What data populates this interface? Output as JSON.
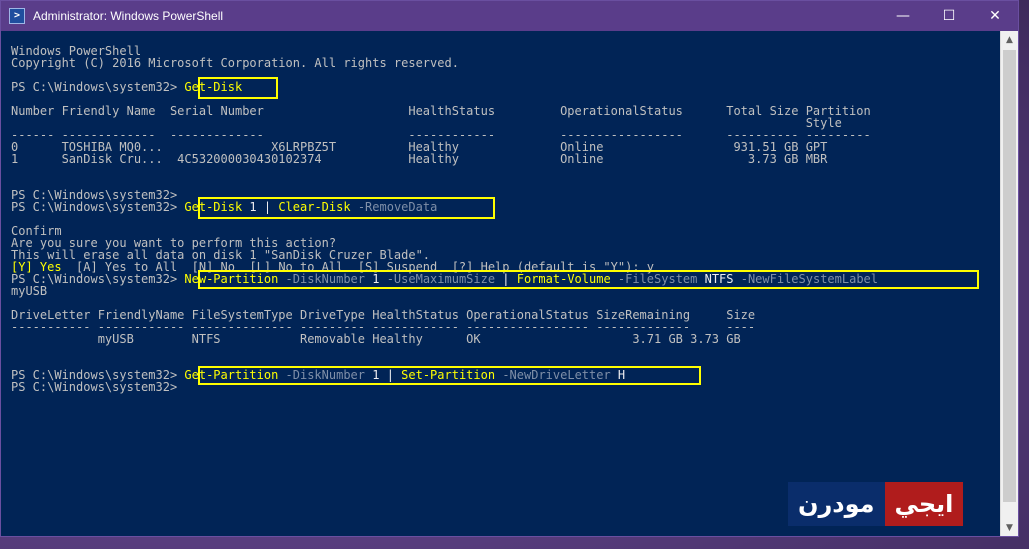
{
  "window": {
    "title": "Administrator: Windows PowerShell",
    "minimize": "—",
    "maximize": "☐",
    "close": "✕",
    "icon_glyph": ">"
  },
  "console": {
    "lines": [
      [
        {
          "t": "Windows PowerShell"
        }
      ],
      [
        {
          "t": "Copyright (C) 2016 Microsoft Corporation. All rights reserved."
        }
      ],
      [
        {
          "t": ""
        }
      ],
      [
        {
          "t": "PS C:\\Windows\\system32> "
        },
        {
          "t": "Get-Disk",
          "c": "yellow"
        }
      ],
      [
        {
          "t": ""
        }
      ],
      [
        {
          "t": "Number Friendly Name  Serial Number                    HealthStatus         OperationalStatus      Total Size Partition"
        }
      ],
      [
        {
          "t": "                                                                                                              Style"
        }
      ],
      [
        {
          "t": "------ -------------  -------------                    ------------         -----------------      ---------- ---------"
        }
      ],
      [
        {
          "t": "0      TOSHIBA MQ0...               X6LRPBZ5T          Healthy              Online                  931.51 GB GPT"
        }
      ],
      [
        {
          "t": "1      SanDisk Cru...  4C532000030430102374            Healthy              Online                    3.73 GB MBR"
        }
      ],
      [
        {
          "t": ""
        }
      ],
      [
        {
          "t": ""
        }
      ],
      [
        {
          "t": "PS C:\\Windows\\system32>"
        }
      ],
      [
        {
          "t": "PS C:\\Windows\\system32> "
        },
        {
          "t": "Get-Disk",
          "c": "yellow"
        },
        {
          "t": " 1 ",
          "c": "white"
        },
        {
          "t": "|",
          "c": "white"
        },
        {
          "t": " Clear-Disk",
          "c": "yellow"
        },
        {
          "t": " -RemoveData",
          "c": "gray"
        }
      ],
      [
        {
          "t": ""
        }
      ],
      [
        {
          "t": "Confirm"
        }
      ],
      [
        {
          "t": "Are you sure you want to perform this action?"
        }
      ],
      [
        {
          "t": "This will erase all data on disk 1 \"SanDisk Cruzer Blade\"."
        }
      ],
      [
        {
          "t": "[Y] Yes",
          "c": "yellow"
        },
        {
          "t": "  [A] Yes to All  [N] No  [L] No to All  [S] Suspend  [?] Help (default is \"Y\"): y"
        }
      ],
      [
        {
          "t": "PS C:\\Windows\\system32> "
        },
        {
          "t": "New-Partition",
          "c": "yellow"
        },
        {
          "t": " -DiskNumber",
          "c": "gray"
        },
        {
          "t": " 1",
          "c": "white"
        },
        {
          "t": " -UseMaximumSize",
          "c": "gray"
        },
        {
          "t": " | ",
          "c": "white"
        },
        {
          "t": "Format-Volume",
          "c": "yellow"
        },
        {
          "t": " -FileSystem",
          "c": "gray"
        },
        {
          "t": " NTFS",
          "c": "white"
        },
        {
          "t": " -NewFileSystemLabel",
          "c": "gray"
        }
      ],
      [
        {
          "t": "myUSB"
        }
      ],
      [
        {
          "t": ""
        }
      ],
      [
        {
          "t": "DriveLetter FriendlyName FileSystemType DriveType HealthStatus OperationalStatus SizeRemaining     Size"
        }
      ],
      [
        {
          "t": "----------- ------------ -------------- --------- ------------ ----------------- -------------     ----"
        }
      ],
      [
        {
          "t": "            myUSB        NTFS           Removable Healthy      OK                     3.71 GB 3.73 GB"
        }
      ],
      [
        {
          "t": ""
        }
      ],
      [
        {
          "t": ""
        }
      ],
      [
        {
          "t": "PS C:\\Windows\\system32> "
        },
        {
          "t": "Get-Partition",
          "c": "yellow"
        },
        {
          "t": " -DiskNumber",
          "c": "gray"
        },
        {
          "t": " 1 ",
          "c": "white"
        },
        {
          "t": "|",
          "c": "white"
        },
        {
          "t": " Set-Partition",
          "c": "yellow"
        },
        {
          "t": " -NewDriveLetter",
          "c": "gray"
        },
        {
          "t": " H",
          "c": "white"
        }
      ],
      [
        {
          "t": "PS C:\\Windows\\system32>"
        }
      ]
    ]
  },
  "watermark": {
    "part1": "مودرن",
    "part2": "ايجي"
  },
  "colors": {
    "console_bg": "#012456",
    "titlebar": "#5a3d8a",
    "highlight_box": "#ffff00"
  }
}
